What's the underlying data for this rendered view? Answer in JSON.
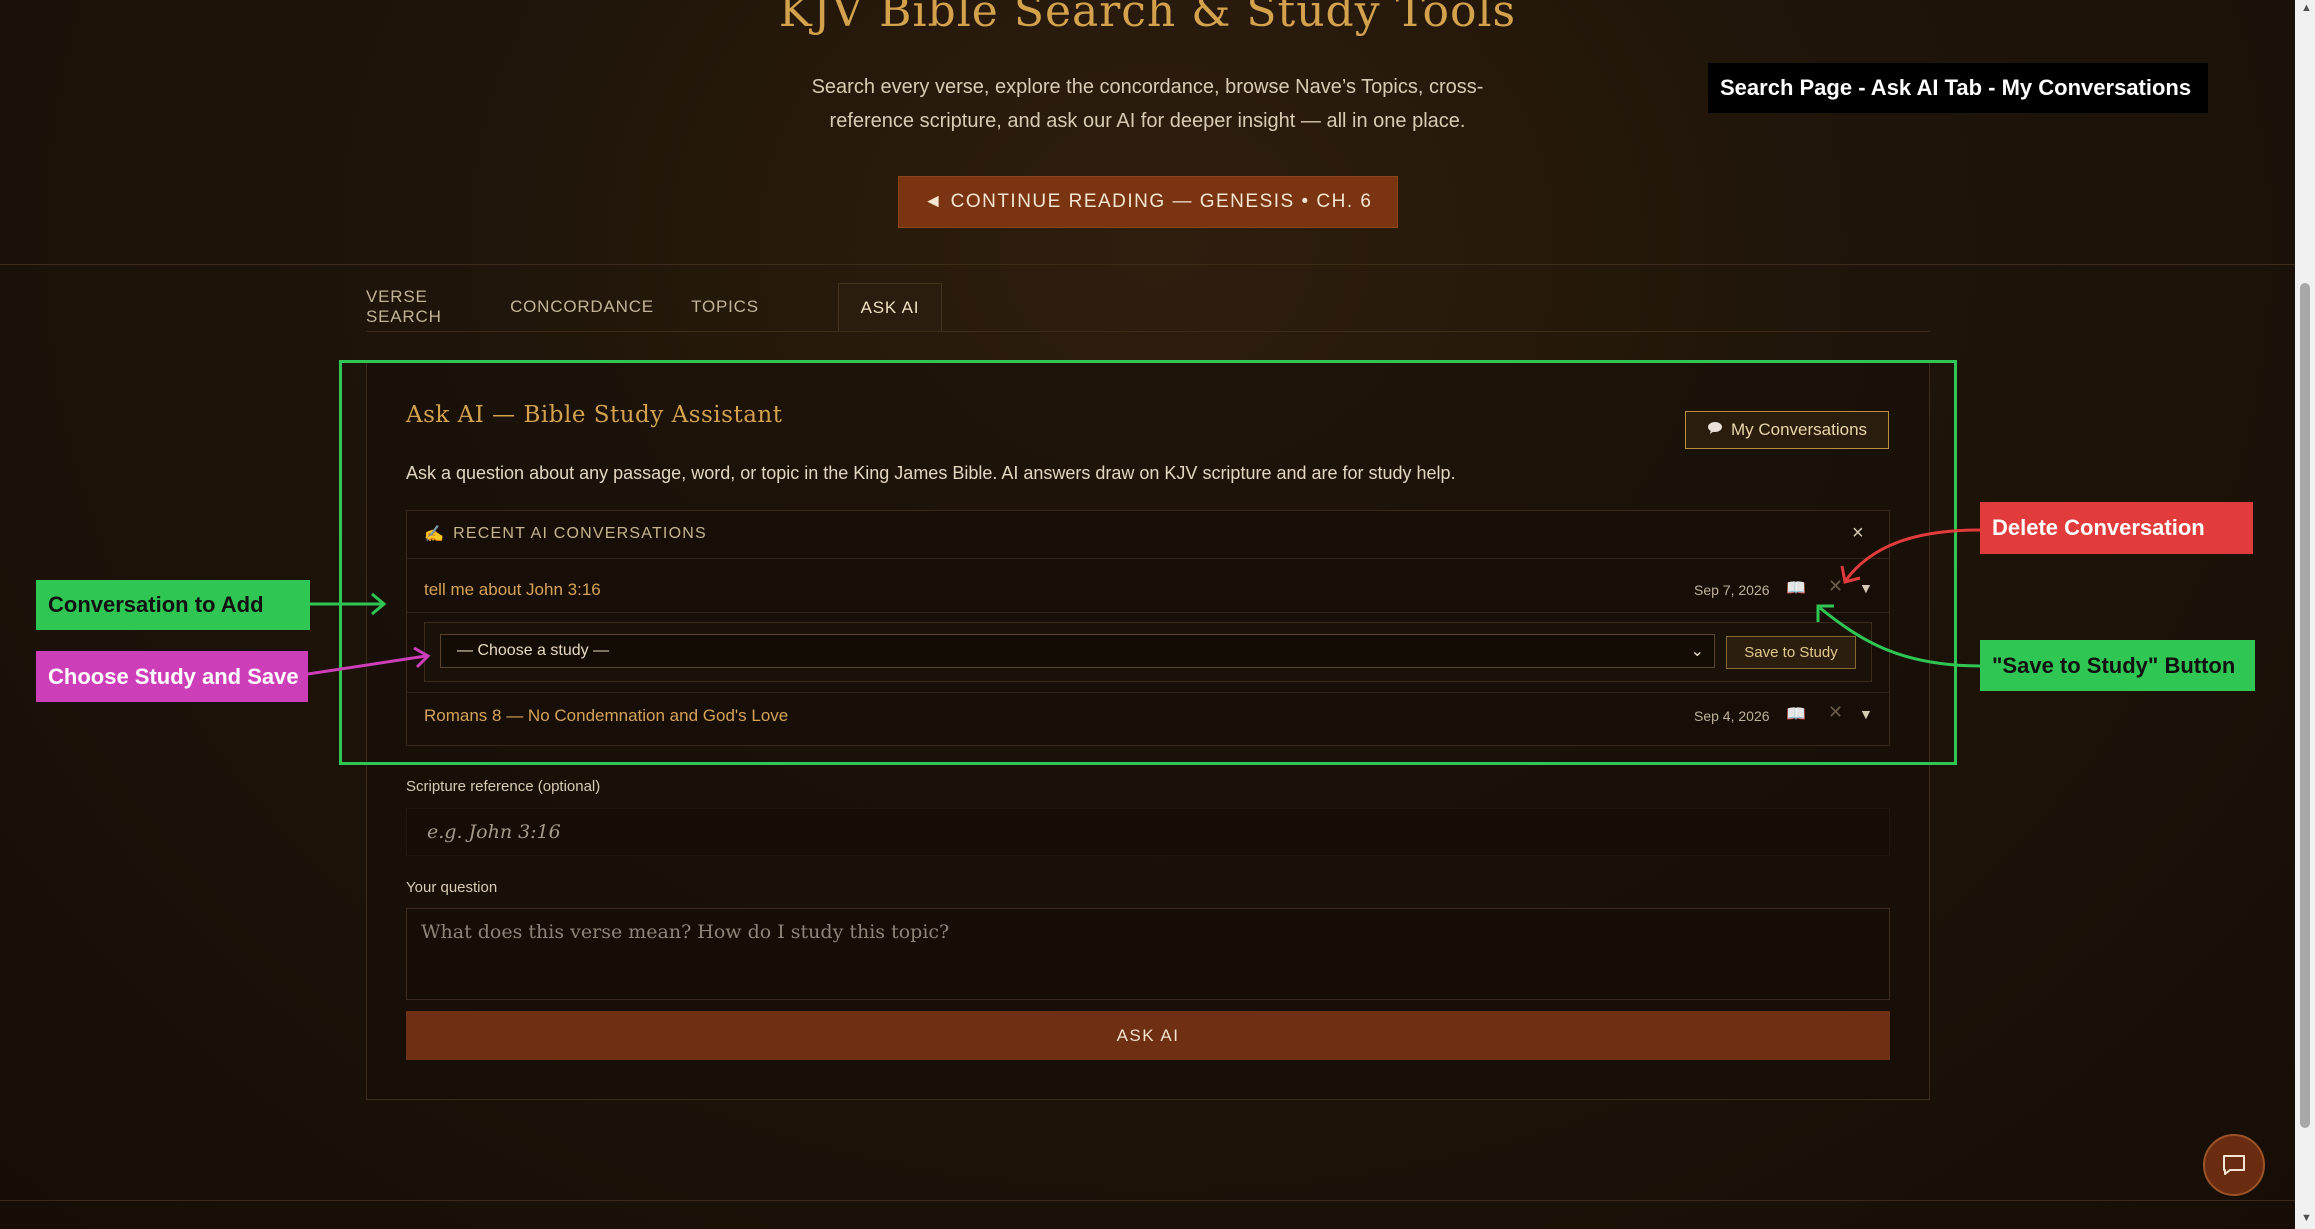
{
  "header": {
    "title": "KJV Bible Search & Study Tools",
    "subtitle_line1": "Search every verse, explore the concordance, browse Nave’s Topics, cross-",
    "subtitle_line2": "reference scripture, and ask our AI for deeper insight — all in one place.",
    "continue_button": "◄ CONTINUE READING — GENESIS • CH. 6"
  },
  "tabs": [
    {
      "label": "VERSE SEARCH",
      "active": false
    },
    {
      "label": "CONCORDANCE",
      "active": false
    },
    {
      "label": "TOPICS",
      "active": false
    },
    {
      "label": "ASK AI",
      "active": true
    }
  ],
  "ask_ai": {
    "title": "Ask AI — Bible Study Assistant",
    "my_conversations_button": "My Conversations",
    "description": "Ask a question about any passage, word, or topic in the King James Bible. AI answers draw on KJV scripture and are for study help.",
    "recent_header": "RECENT AI CONVERSATIONS",
    "close_symbol": "×",
    "conversations": [
      {
        "title": "tell me about John 3:16",
        "date": "Sep 7, 2026"
      },
      {
        "title": "Romans 8 — No Condemnation and God's Love",
        "date": "Sep 4, 2026"
      }
    ],
    "study_select_value": "— Choose a study —",
    "save_to_study_button": "Save to Study",
    "scripture_label": "Scripture reference (optional)",
    "scripture_placeholder": "e.g. John 3:16",
    "question_label": "Your question",
    "question_placeholder": "What does this verse mean? How do I study this topic?",
    "ask_button": "ASK AI"
  },
  "annotations": {
    "page_label": "Search Page - Ask AI Tab - My Conversations",
    "delete_conversation": "Delete Conversation",
    "conversation_to_add": "Conversation to Add",
    "choose_study_and_save": "Choose Study and Save",
    "save_to_study_button": "\"Save to Study\" Button"
  },
  "colors": {
    "accent_gold": "#d4a24c",
    "button_rust": "#7a3412",
    "highlight_green": "#2fc653",
    "annotation_red": "#e23b3b",
    "annotation_pink": "#cc3fb9"
  },
  "icons": [
    "speech-bubble-icon",
    "writing-hand-icon",
    "book-icon",
    "close-icon",
    "caret-down-icon",
    "chat-icon"
  ]
}
